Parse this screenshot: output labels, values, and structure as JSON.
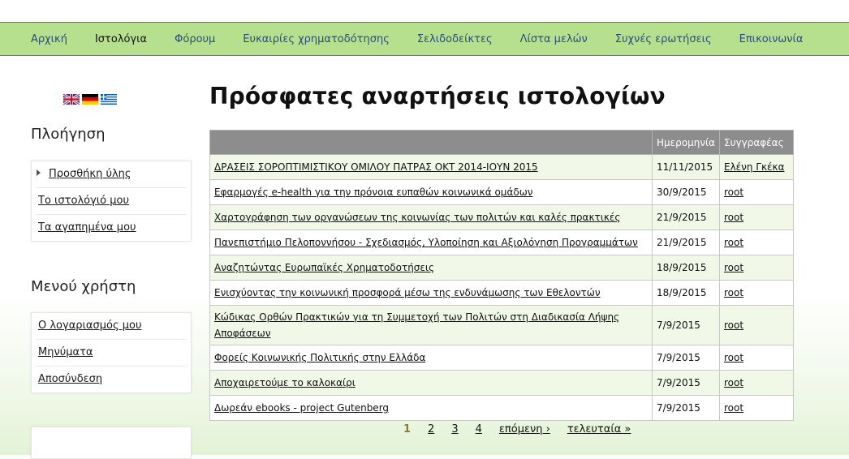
{
  "nav": {
    "items": [
      {
        "label": "Αρχική"
      },
      {
        "label": "Ιστολόγια"
      },
      {
        "label": "Φόρουμ"
      },
      {
        "label": "Ευκαιρίες χρηματοδότησης"
      },
      {
        "label": "Σελιδοδείκτες"
      },
      {
        "label": "Λίστα μελών"
      },
      {
        "label": "Συχνές ερωτήσεις"
      },
      {
        "label": "Επικοινωνία"
      }
    ]
  },
  "sidebar": {
    "nav_title": "Πλοήγηση",
    "nav_items": [
      {
        "label": "Προσθήκη ύλης"
      },
      {
        "label": "Το ιστολόγιό μου"
      },
      {
        "label": "Τα αγαπημένα μου"
      }
    ],
    "user_title": "Μενού χρήστη",
    "user_items": [
      {
        "label": "Ο λογαριασμός μου"
      },
      {
        "label": "Μηνύματα"
      },
      {
        "label": "Αποσύνδεση"
      }
    ]
  },
  "main": {
    "title": "Πρόσφατες αναρτήσεις ιστολογίων",
    "columns": {
      "title": "",
      "date": "Ημερομηνία",
      "author": "Συγγραφέας"
    },
    "rows": [
      {
        "title": "ΔΡΑΣΕΙΣ ΣΟΡΟΠΤΙΜΙΣΤΙΚΟΥ ΟΜΙΛΟΥ ΠΑΤΡΑΣ ΟΚΤ 2014-ΙΟΥΝ 2015",
        "date": "11/11/2015",
        "author": "Ελένη Γκέκα"
      },
      {
        "title": "Εφαρμογές e-health για την πρόνοια ευπαθών κοινωνικά ομάδων",
        "date": "30/9/2015",
        "author": "root"
      },
      {
        "title": "Χαρτογράφηση των οργανώσεων της κοινωνίας των πολιτών και καλές πρακτικές",
        "date": "21/9/2015",
        "author": "root"
      },
      {
        "title": "Πανεπιστήμιο Πελοποννήσου - Σχεδιασμός, Υλοποίηση και Αξιολόγηση Προγραμμάτων",
        "date": "21/9/2015",
        "author": "root"
      },
      {
        "title": "Αναζητώντας Ευρωπαϊκές Χρηματοδοτήσεις",
        "date": "18/9/2015",
        "author": "root"
      },
      {
        "title": "Ενισχύοντας την κοινωνική προσφορά μέσω της ενδυνάμωσης των Εθελοντών",
        "date": "18/9/2015",
        "author": "root"
      },
      {
        "title": "Κώδικας Ορθών Πρακτικών για τη Συμμετοχή των Πολιτών στη Διαδικασία Λήψης Αποφάσεων",
        "date": "7/9/2015",
        "author": "root"
      },
      {
        "title": "Φορείς Κοινωνικής Πολιτικής στην Ελλάδα",
        "date": "7/9/2015",
        "author": "root"
      },
      {
        "title": "Αποχαιρετούμε το καλοκαίρι",
        "date": "7/9/2015",
        "author": "root"
      },
      {
        "title": "Δωρεάν ebooks - project Gutenberg",
        "date": "7/9/2015",
        "author": "root"
      }
    ]
  },
  "pager": {
    "pages": [
      "1",
      "2",
      "3",
      "4"
    ],
    "next": "επόμενη ›",
    "last": "τελευταία »"
  },
  "colors": {
    "nav_bg": "#b6e08e",
    "nav_link": "#2a4a86",
    "table_header_bg": "#8d8d8d",
    "row_alt_bg": "#f1f8e8"
  },
  "flags": [
    {
      "icon": "uk-flag-icon"
    },
    {
      "icon": "germany-flag-icon"
    },
    {
      "icon": "greece-flag-icon"
    }
  ]
}
